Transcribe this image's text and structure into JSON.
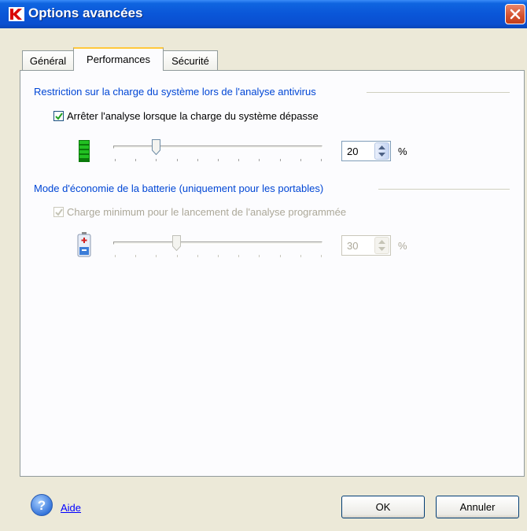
{
  "window": {
    "title": "Options avancées"
  },
  "tabs": [
    {
      "label": "Général"
    },
    {
      "label": "Performances",
      "active": true
    },
    {
      "label": "Sécurité"
    }
  ],
  "group_load": {
    "title": "Restriction sur la charge du système lors de l'analyse antivirus",
    "checkbox_label": "Arrêter l'analyse lorsque la charge du système dépasse",
    "checked": true,
    "slider_fraction": 0.2,
    "value": "20",
    "unit": "%"
  },
  "group_battery": {
    "title": "Mode d'économie de la batterie (uniquement pour les portables)",
    "checkbox_label": "Charge minimum pour le lancement de l'analyse programmée",
    "checked": true,
    "disabled": true,
    "slider_fraction": 0.3,
    "value": "30",
    "unit": "%"
  },
  "footer": {
    "help_label": "Aide",
    "ok_label": "OK",
    "cancel_label": "Annuler"
  },
  "colors": {
    "group_title": "#0046D5",
    "accent": "#0A56D8",
    "close": "#D3502D"
  }
}
